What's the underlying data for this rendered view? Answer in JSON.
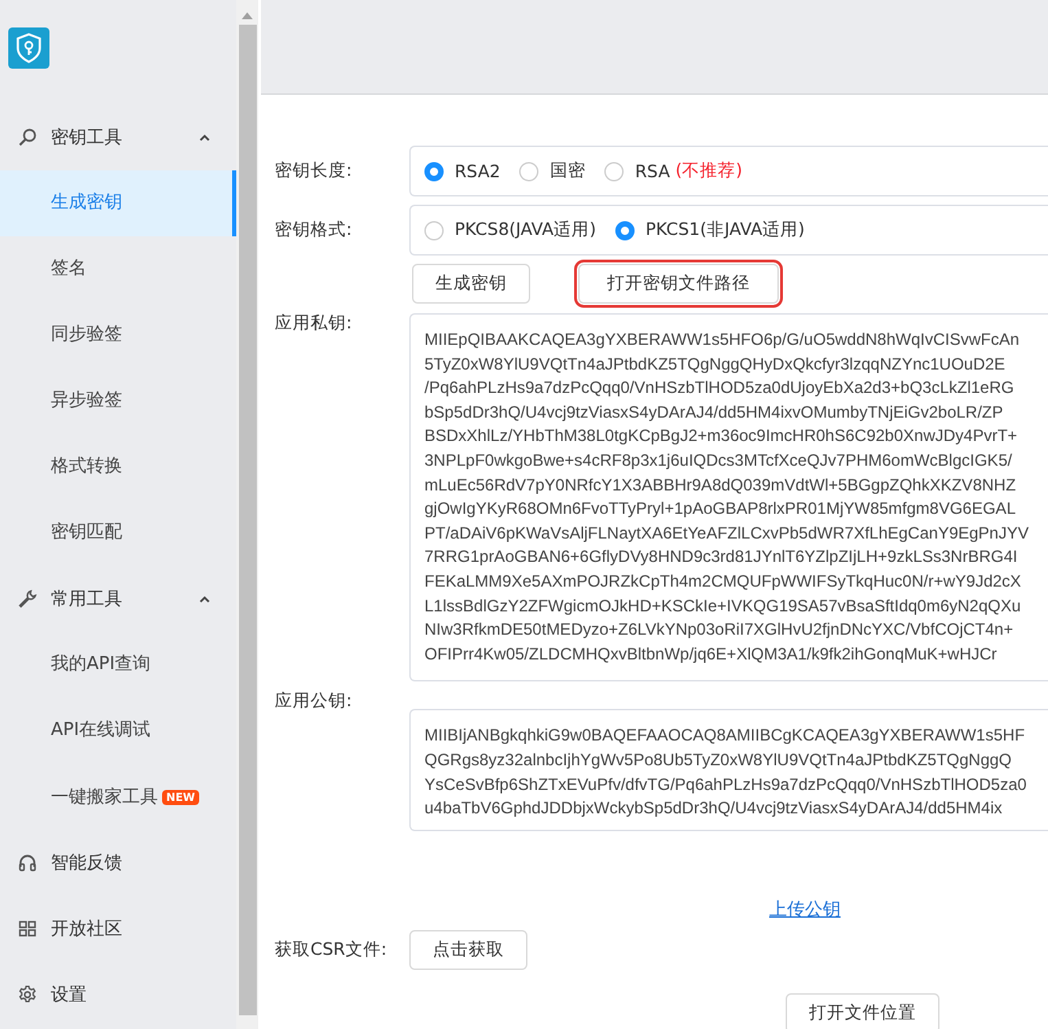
{
  "sidebar": {
    "groups": [
      {
        "label": "密钥工具",
        "expanded": true,
        "items": [
          {
            "label": "生成密钥",
            "selected": true
          },
          {
            "label": "签名",
            "selected": false
          },
          {
            "label": "同步验签",
            "selected": false
          },
          {
            "label": "异步验签",
            "selected": false
          },
          {
            "label": "格式转换",
            "selected": false
          },
          {
            "label": "密钥匹配",
            "selected": false
          }
        ]
      },
      {
        "label": "常用工具",
        "expanded": true,
        "items": [
          {
            "label": "我的API查询",
            "selected": false
          },
          {
            "label": "API在线调试",
            "selected": false
          },
          {
            "label": "一键搬家工具",
            "selected": false,
            "badge": "NEW"
          }
        ]
      },
      {
        "label": "智能反馈"
      },
      {
        "label": "开放社区"
      },
      {
        "label": "设置"
      }
    ]
  },
  "form": {
    "key_length": {
      "label": "密钥长度:",
      "options": [
        {
          "label": "RSA2",
          "selected": true
        },
        {
          "label": "国密",
          "selected": false
        },
        {
          "label": "RSA",
          "selected": false,
          "note": "(不推荐)"
        }
      ]
    },
    "key_format": {
      "label": "密钥格式:",
      "options": [
        {
          "label": "PKCS8(JAVA适用)",
          "selected": false
        },
        {
          "label": "PKCS1(非JAVA适用)",
          "selected": true
        }
      ]
    },
    "buttons": [
      {
        "label": "生成密钥",
        "highlighted": false
      },
      {
        "label": "打开密钥文件路径",
        "highlighted": true
      }
    ],
    "private_key": {
      "label": "应用私钥:",
      "lines": [
        "MIIEpQIBAAKCAQEA3gYXBERAWW1s5HFO6p/G/uO5wddN8hWqIvCISvwFcAn",
        "5TyZ0xW8YlU9VQtTn4aJPtbdKZ5TQgNggQHyDxQkcfyr3lzqqNZYnc1UOuD2E",
        "/Pq6ahPLzHs9a7dzPcQqq0/VnHSzbTlHOD5za0dUjoyEbXa2d3+bQ3cLkZl1eRG",
        "bSp5dDr3hQ/U4vcj9tzViasxS4yDArAJ4/dd5HM4ixvOMumbyTNjEiGv2boLR/ZP",
        "BSDxXhlLz/YHbThM38L0tgKCpBgJ2+m36oc9ImcHR0hS6C92b0XnwJDy4PvrT+",
        "3NPLpF0wkgoBwe+s4cRF8p3x1j6uIQDcs3MTcfXceQJv7PHM6omWcBlgcIGK5/",
        "mLuEc56RdV7pY0NRfcY1X3ABBHr9A8dQ039mVdtWl+5BGgpZQhkXKZV8NHZ",
        "gjOwIgYKyR68OMn6FvoTTyPryl+1pAoGBAP8rlxPR01MjYW85mfgm8VG6EGAL",
        "PT/aDAiV6pKWaVsAljFLNaytXA6EtYeAFZlLCxvPb5dWR7XfLhEgCanY9EgPnJYV",
        "7RRG1prAoGBAN6+6GflyDVy8HND9c3rd81JYnlT6YZlpZIjLH+9zkLSs3NrBRG4I",
        "FEKaLMM9Xe5AXmPOJRZkCpTh4m2CMQUFpWWIFSyTkqHuc0N/r+wY9Jd2cX",
        "L1lssBdlGzY2ZFWgicmOJkHD+KSCkIe+IVKQG19SA57vBsaSftIdq0m6yN2qQXu",
        "NIw3RfkmDE50tMEDyzo+Z6LVkYNp03oRiI7XGlHvU2fjnDNcYXC/VbfCOjCT4n+",
        "OFIPrr4Kw05/ZLDCMHQxvBltbnWp/jq6E+XlQM3A1/k9fk2ihGonqMuK+wHJCr"
      ]
    },
    "public_key": {
      "label": "应用公钥:",
      "lines": [
        "MIIBIjANBgkqhkiG9w0BAQEFAAOCAQ8AMIIBCgKCAQEA3gYXBERAWW1s5HF",
        "QGRgs8yz32alnbcIjhYgWv5Po8Ub5TyZ0xW8YlU9VQtTn4aJPtbdKZ5TQgNggQ",
        "YsCeSvBfp6ShZTxEVuPfv/dfvTG/Pq6ahPLzHs9a7dzPcQqq0/VnHSzbTlHOD5za0",
        "u4baTbV6GphdJDDbjxWckybSp5dDr3hQ/U4vcj9tzViasxS4yDArAJ4/dd5HM4ix"
      ]
    },
    "upload_link": "上传公钥",
    "csr": {
      "label": "获取CSR文件:",
      "button": "点击获取"
    },
    "open_location_button": "打开文件位置"
  }
}
